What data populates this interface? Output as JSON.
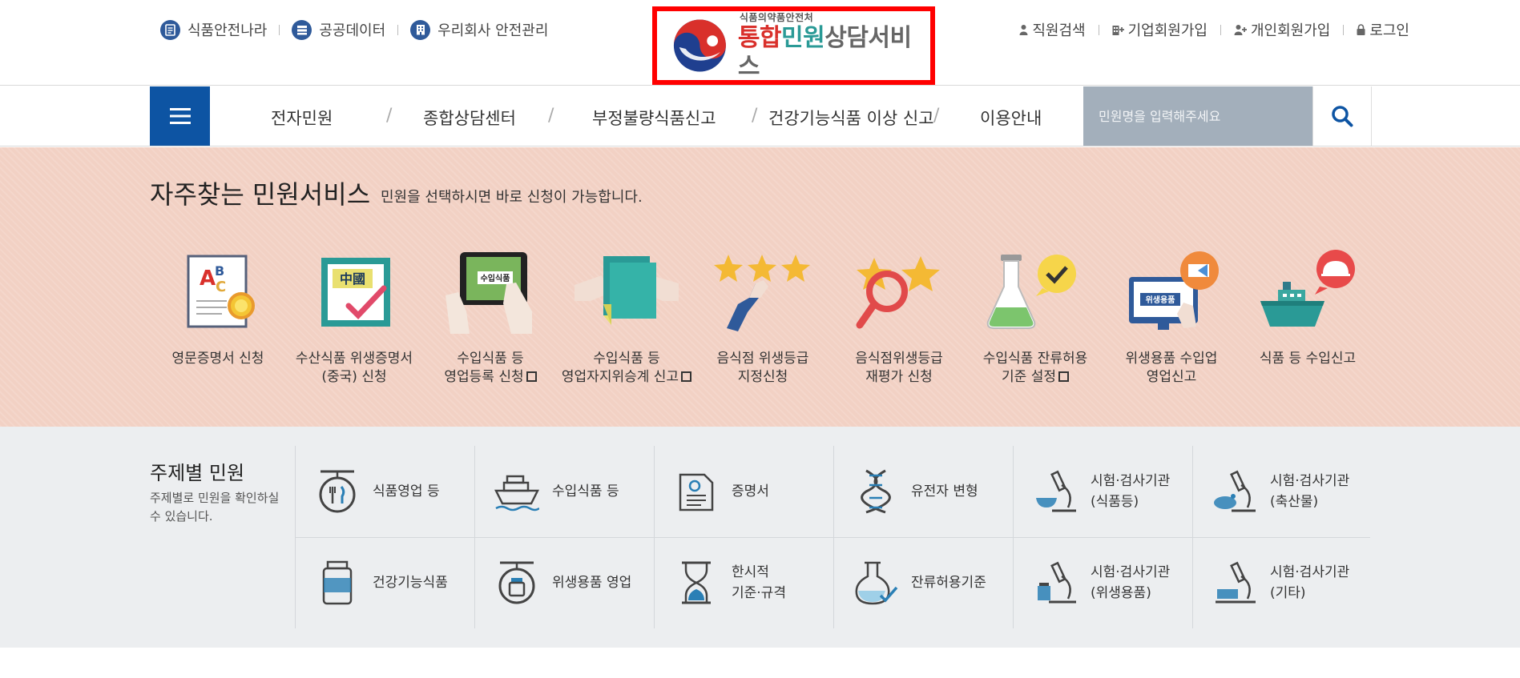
{
  "header": {
    "util_left": [
      {
        "label": "식품안전나라",
        "icon": "document-icon"
      },
      {
        "label": "공공데이터",
        "icon": "database-icon"
      },
      {
        "label": "우리회사 안전관리",
        "icon": "building-icon"
      }
    ],
    "util_right": [
      {
        "label": "직원검색",
        "icon": "person-icon"
      },
      {
        "label": "기업회원가입",
        "icon": "company-add-icon"
      },
      {
        "label": "개인회원가입",
        "icon": "person-add-icon"
      },
      {
        "label": "로그인",
        "icon": "lock-icon"
      }
    ],
    "logo": {
      "sub": "식품의약품안전처",
      "main_part1": "통합",
      "main_part2": "민원",
      "main_part3": "상담서비스"
    }
  },
  "gnb": {
    "menu_icon": "hamburger-menu-icon",
    "items": [
      "전자민원",
      "종합상담센터",
      "부정불량식품신고",
      "건강기능식품 이상 신고",
      "이용안내"
    ],
    "search_placeholder": "민원명을 입력해주세요",
    "search_icon": "search-icon"
  },
  "frequent": {
    "title": "자주찾는 민원서비스",
    "subtitle": "민원을 선택하시면 바로 신청이 가능합니다.",
    "items": [
      {
        "line1": "영문증명서 신청",
        "line2": "",
        "external": false,
        "icon": "certificate-abc-icon"
      },
      {
        "line1": "수산식품 위생증명서",
        "line2": "(중국) 신청",
        "external": false,
        "icon": "china-certificate-icon",
        "icon_text": "中國"
      },
      {
        "line1": "수입식품 등",
        "line2": "영업등록 신청",
        "external": true,
        "icon": "tablet-import-icon",
        "icon_text": "수입식품"
      },
      {
        "line1": "수입식품 등",
        "line2": "영업자지위승계 신고",
        "external": true,
        "icon": "document-handover-icon"
      },
      {
        "line1": "음식점 위생등급",
        "line2": "지정신청",
        "external": false,
        "icon": "hand-stars-icon"
      },
      {
        "line1": "음식점위생등급",
        "line2": "재평가 신청",
        "external": false,
        "icon": "magnifier-star-icon"
      },
      {
        "line1": "수입식품 잔류허용",
        "line2": "기준 설정",
        "external": true,
        "icon": "flask-check-icon"
      },
      {
        "line1": "위생용품 수입업",
        "line2": "영업신고",
        "external": false,
        "icon": "monitor-hygiene-icon",
        "icon_text": "위생용품"
      },
      {
        "line1": "식품 등 수입신고",
        "line2": "",
        "external": false,
        "icon": "ship-cloche-icon"
      }
    ]
  },
  "topic": {
    "title": "주제별 민원",
    "desc": "주제별로 민원을 확인하실 수 있습니다.",
    "items": [
      {
        "line1": "식품영업 등",
        "line2": "",
        "icon": "restaurant-sign-icon"
      },
      {
        "line1": "수입식품 등",
        "line2": "",
        "icon": "cargo-ship-icon"
      },
      {
        "line1": "증명서",
        "line2": "",
        "icon": "certificate-icon"
      },
      {
        "line1": "유전자 변형",
        "line2": "",
        "icon": "dna-icon"
      },
      {
        "line1": "시험·검사기관",
        "line2": "(식품등)",
        "icon": "microscope-bowl-icon"
      },
      {
        "line1": "시험·검사기관",
        "line2": "(축산물)",
        "icon": "microscope-chicken-icon"
      },
      {
        "line1": "건강기능식품",
        "line2": "",
        "icon": "supplement-bottle-icon"
      },
      {
        "line1": "위생용품 영업",
        "line2": "",
        "icon": "hygiene-sign-icon"
      },
      {
        "line1": "한시적",
        "line2": "기준·규격",
        "icon": "hourglass-icon"
      },
      {
        "line1": "잔류허용기준",
        "line2": "",
        "icon": "flask-check-outline-icon"
      },
      {
        "line1": "시험·검사기관",
        "line2": "(위생용품)",
        "icon": "microscope-cup-icon"
      },
      {
        "line1": "시험·검사기관",
        "line2": "(기타)",
        "icon": "microscope-other-icon"
      }
    ]
  },
  "colors": {
    "primary_blue": "#0d54a3",
    "search_bg": "#a3afbb",
    "frequent_bg": "#f2d1c4",
    "topic_bg": "#eceef0",
    "logo_border": "#ff0000",
    "logo_red": "#d9302b",
    "logo_teal": "#2a9a96"
  }
}
